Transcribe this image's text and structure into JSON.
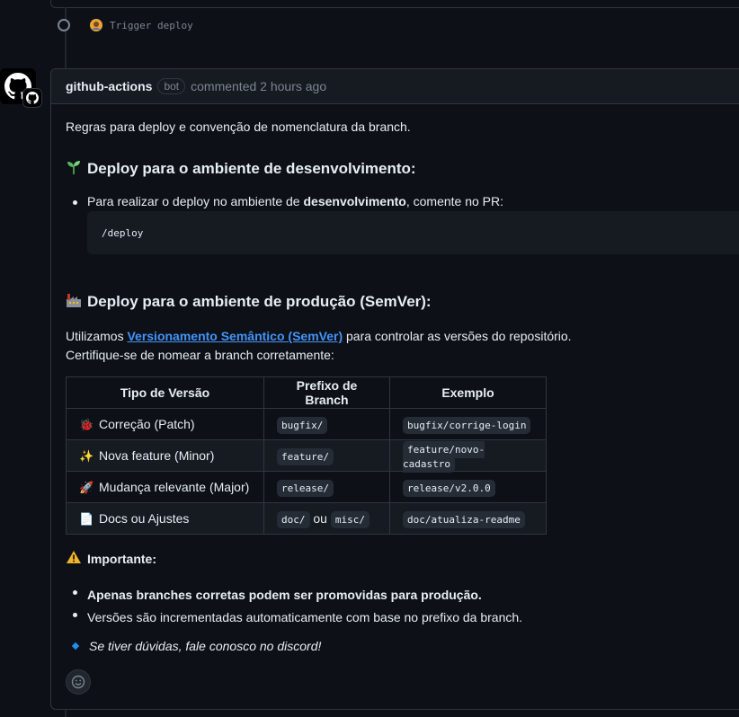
{
  "commit": {
    "message": "Trigger deploy"
  },
  "comment": {
    "author": "github-actions",
    "badge": "bot",
    "meta": "commented 2 hours ago",
    "intro": "Regras para deploy e convenção de nomenclatura da branch.",
    "dev_heading": "Deploy para o ambiente de desenvolvimento:",
    "dev_bullet_prefix": "Para realizar o deploy no ambiente de ",
    "dev_bullet_bold": "desenvolvimento",
    "dev_bullet_suffix": ", comente no PR:",
    "code": "/deploy",
    "prod_heading": "Deploy para o ambiente de produção (SemVer):",
    "semver_prefix": "Utilizamos ",
    "semver_link": "Versionamento Semântico (SemVer)",
    "semver_suffix": " para controlar as versões do repositório.",
    "semver_line2": "Certifique-se de nomear a branch corretamente:",
    "table": {
      "headers": [
        "Tipo de Versão",
        "Prefixo de Branch",
        "Exemplo"
      ],
      "rows": [
        {
          "icon": "bug-icon",
          "type": "Correção (Patch)",
          "prefix": "bugfix/",
          "example": "bugfix/corrige-login"
        },
        {
          "icon": "sparkles-icon",
          "type": "Nova feature (Minor)",
          "prefix": "feature/",
          "example": "feature/novo-cadastro"
        },
        {
          "icon": "rocket-icon",
          "type": "Mudança relevante (Major)",
          "prefix": "release/",
          "example": "release/v2.0.0"
        },
        {
          "icon": "document-icon",
          "type": "Docs ou Ajustes",
          "prefix": "doc/",
          "prefix_or": "ou",
          "prefix2": "misc/",
          "example": "doc/atualiza-readme"
        }
      ]
    },
    "important_heading": "Importante:",
    "important_items": [
      "Apenas branches corretas podem ser promovidas para produção.",
      "Versões são incrementadas automaticamente com base no prefixo da branch."
    ],
    "discord": "Se tiver dúvidas, fale conosco no discord!"
  },
  "colors": {
    "background": "#0d1117",
    "border": "#30363d",
    "link": "#4493f8",
    "muted": "#7d8590"
  }
}
